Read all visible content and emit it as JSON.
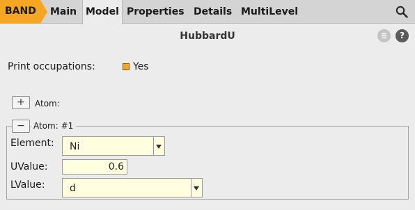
{
  "app": {
    "name": "BAND",
    "brand_color": "#f5a623"
  },
  "tabs": [
    {
      "label": "Main",
      "active": false
    },
    {
      "label": "Model",
      "active": true
    },
    {
      "label": "Properties",
      "active": false
    },
    {
      "label": "Details",
      "active": false
    },
    {
      "label": "MultiLevel",
      "active": false
    }
  ],
  "header": {
    "title": "HubbardU",
    "help_glyph": "?"
  },
  "print_occupations": {
    "label": "Print occupations:",
    "value_label": "Yes",
    "checked": true
  },
  "atom_add": {
    "button": "+",
    "label": "Atom:"
  },
  "atom_group": {
    "button": "−",
    "legend": "Atom: #1",
    "element": {
      "label": "Element:",
      "value": "Ni"
    },
    "uvalue": {
      "label": "UValue:",
      "value": "0.6"
    },
    "lvalue": {
      "label": "LValue:",
      "value": "d"
    }
  }
}
